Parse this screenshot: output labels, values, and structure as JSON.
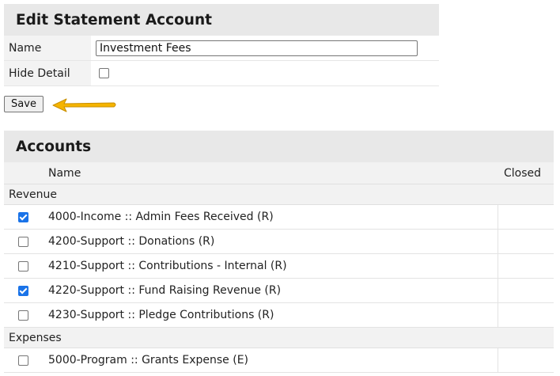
{
  "edit_panel": {
    "title": "Edit Statement Account",
    "name_label": "Name",
    "name_value": "Investment Fees",
    "hide_detail_label": "Hide Detail",
    "hide_detail_checked": false
  },
  "save_label": "Save",
  "accounts": {
    "title": "Accounts",
    "columns": {
      "name": "Name",
      "closed": "Closed"
    },
    "groups": [
      {
        "label": "Revenue",
        "rows": [
          {
            "name": "4000-Income :: Admin Fees Received (R)",
            "checked": true
          },
          {
            "name": "4200-Support :: Donations (R)",
            "checked": false
          },
          {
            "name": "4210-Support :: Contributions - Internal (R)",
            "checked": false
          },
          {
            "name": "4220-Support :: Fund Raising Revenue (R)",
            "checked": true
          },
          {
            "name": "4230-Support :: Pledge Contributions (R)",
            "checked": false
          }
        ]
      },
      {
        "label": "Expenses",
        "rows": [
          {
            "name": "5000-Program :: Grants Expense (E)",
            "checked": false
          }
        ]
      }
    ]
  },
  "colors": {
    "accent": "#1a73e8",
    "arrow": "#f5b400",
    "header_bg": "#e8e8e8"
  },
  "icons": {
    "arrow": "arrow-left-icon"
  }
}
